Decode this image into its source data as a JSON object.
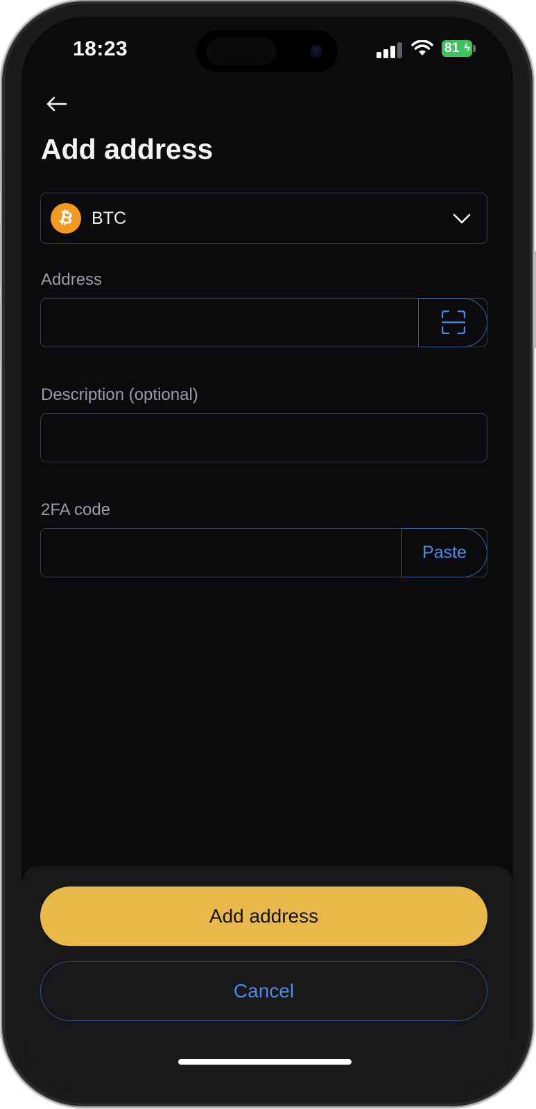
{
  "status_bar": {
    "time": "18:23",
    "battery_level": "81",
    "battery_charging": true,
    "signal_bars": 3,
    "wifi": true
  },
  "header": {
    "back_icon": "arrow-left-icon",
    "title": "Add address"
  },
  "currency_select": {
    "icon": "bitcoin-icon",
    "icon_letter": "₿",
    "value": "BTC",
    "chevron_icon": "chevron-down-icon"
  },
  "address": {
    "label": "Address",
    "value": "",
    "scan_icon": "qr-scan-icon"
  },
  "description": {
    "label": "Description (optional)",
    "value": ""
  },
  "twofa": {
    "label": "2FA code",
    "value": "",
    "paste_label": "Paste"
  },
  "actions": {
    "primary_label": "Add address",
    "secondary_label": "Cancel"
  },
  "colors": {
    "background": "#0b0b0d",
    "sheet": "#18181b",
    "accent_yellow": "#e8b84b",
    "accent_blue": "#4c8ae6",
    "bitcoin_orange": "#f29a1f",
    "battery_green": "#3bc45e"
  }
}
